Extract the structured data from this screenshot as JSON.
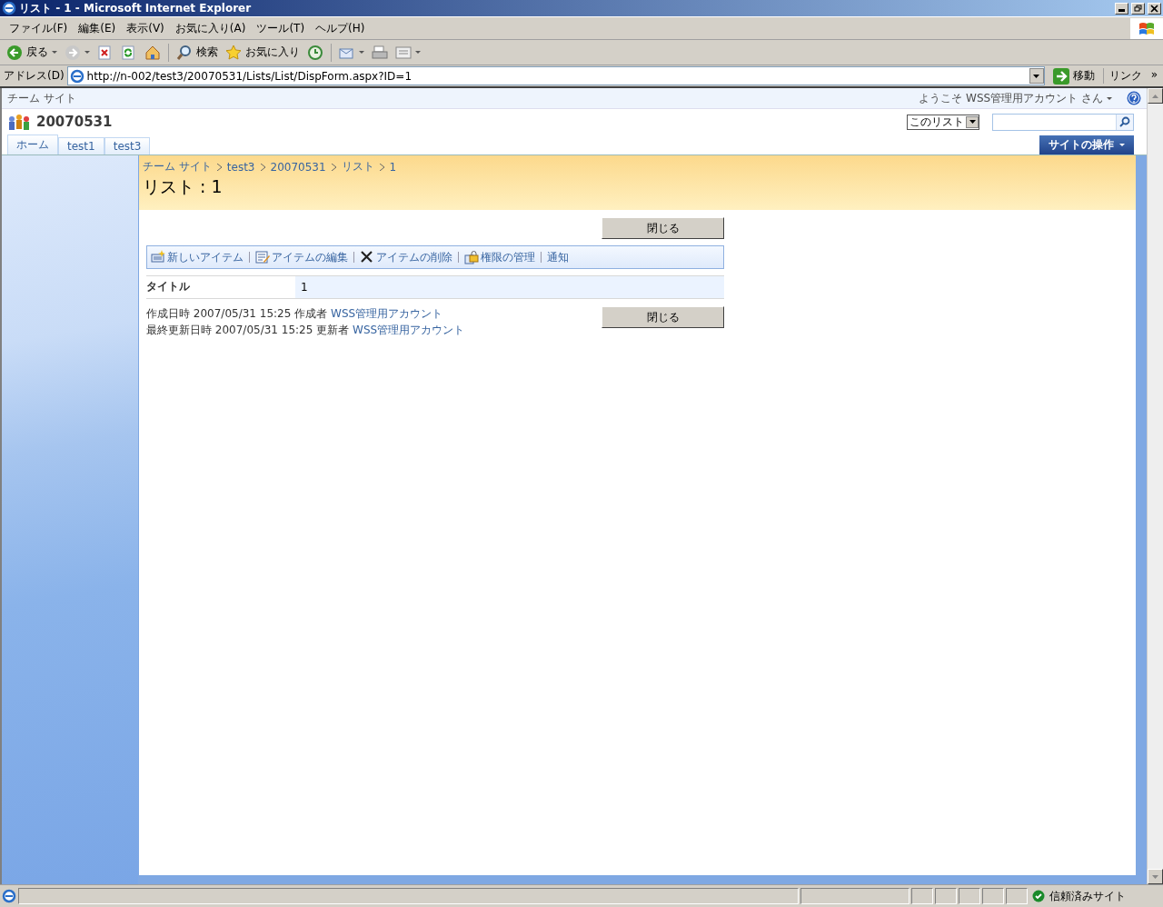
{
  "window": {
    "title": "リスト - 1 - Microsoft Internet Explorer"
  },
  "menu_bar": [
    "ファイル(F)",
    "編集(E)",
    "表示(V)",
    "お気に入り(A)",
    "ツール(T)",
    "ヘルプ(H)"
  ],
  "toolbar": [
    {
      "kind": "back",
      "label": "戻る"
    },
    {
      "kind": "forward"
    },
    {
      "kind": "stop"
    },
    {
      "kind": "refresh"
    },
    {
      "kind": "home"
    },
    {
      "kind": "search",
      "label": "検索"
    },
    {
      "kind": "favorites",
      "label": "お気に入り"
    },
    {
      "kind": "history"
    },
    {
      "kind": "mail"
    },
    {
      "kind": "print"
    },
    {
      "kind": "edit"
    }
  ],
  "address_bar": {
    "label": "アドレス(D)",
    "value": "http://n-002/test3/20070531/Lists/List/DispForm.aspx?ID=1",
    "go": "移動",
    "links": "リンク",
    "more": "»"
  },
  "site": {
    "top_link": "チーム サイト",
    "welcome": "ようこそ WSS管理用アカウント さん",
    "title": "20070531",
    "scope": "このリスト",
    "site_actions": "サイトの操作",
    "tabs": [
      {
        "label": "ホーム"
      },
      {
        "label": "test1"
      },
      {
        "label": "test3"
      }
    ]
  },
  "breadcrumb": [
    "チーム サイト",
    "test3",
    "20070531",
    "リスト",
    "1"
  ],
  "page_title": "リスト : 1",
  "close_buttons": [
    "閉じる",
    "閉じる"
  ],
  "actions": [
    {
      "kind": "new",
      "label": "新しいアイテム"
    },
    {
      "kind": "edit",
      "label": "アイテムの編集"
    },
    {
      "kind": "delete",
      "label": "アイテムの削除"
    },
    {
      "kind": "permissions",
      "label": "権限の管理"
    },
    {
      "kind": "alert",
      "label": "通知"
    }
  ],
  "fields": [
    {
      "label": "タイトル",
      "value": "1"
    }
  ],
  "audit": [
    {
      "text": "作成日時 2007/05/31 15:25",
      "by_label": "作成者",
      "by": "WSS管理用アカウント"
    },
    {
      "text": "最終更新日時 2007/05/31 15:25",
      "by_label": "更新者",
      "by": "WSS管理用アカウント"
    }
  ],
  "status_bar": {
    "zone": "信頼済みサイト"
  }
}
